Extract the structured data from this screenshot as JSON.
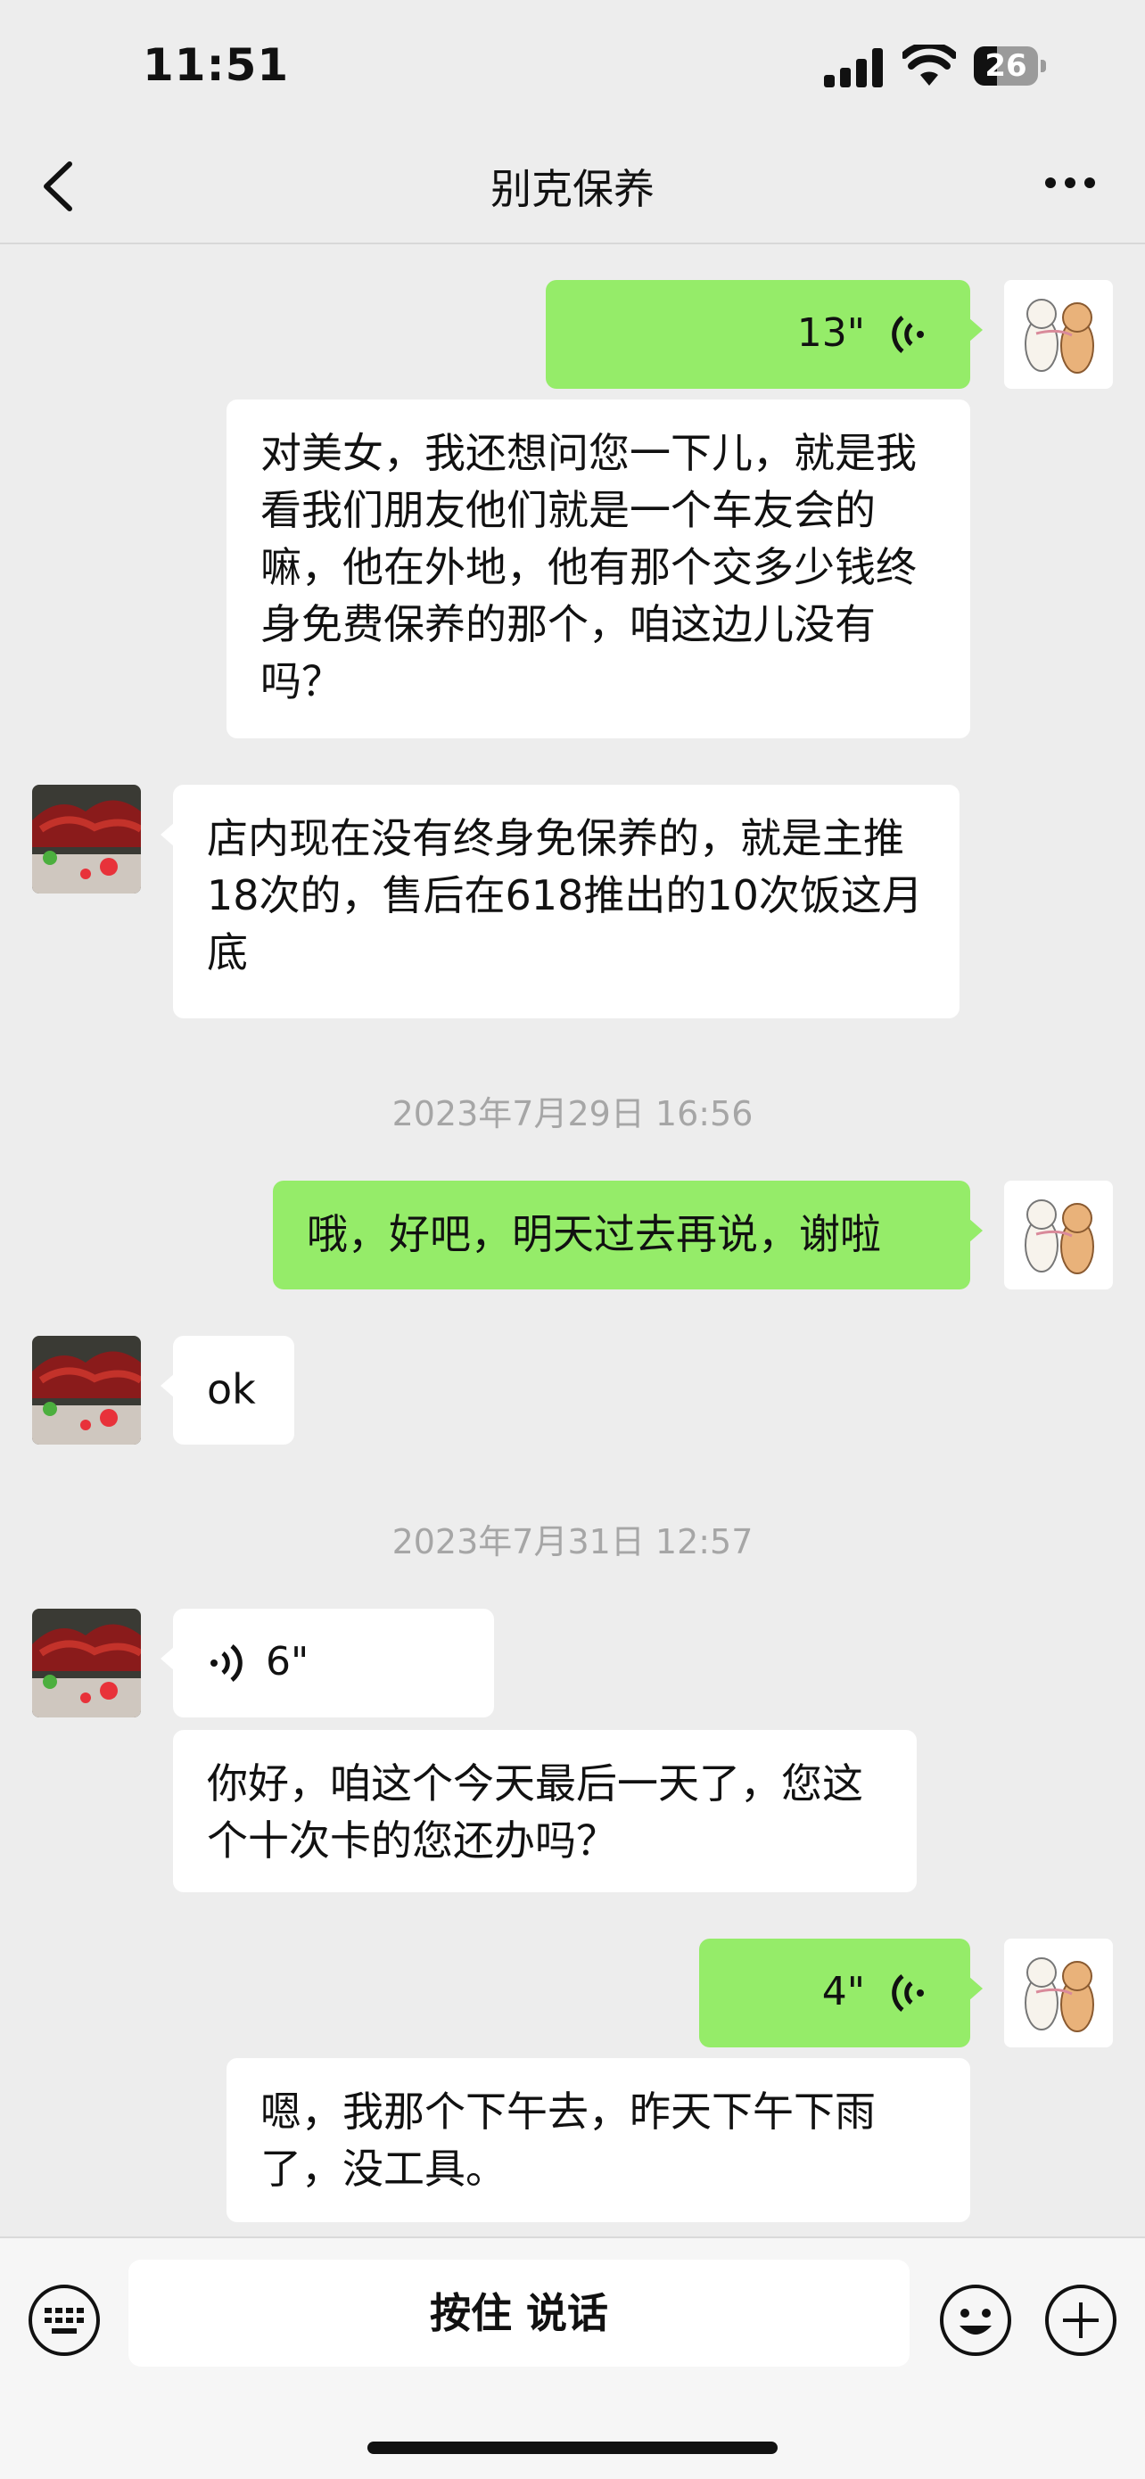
{
  "status": {
    "time": "11:51",
    "battery": "26"
  },
  "nav": {
    "title": "别克保养"
  },
  "messages": [
    {
      "side": "right",
      "kind": "voice",
      "duration": "13\""
    },
    {
      "side": "right",
      "kind": "text",
      "text": "对美女，我还想问您一下儿，就是我看我们朋友他们就是一个车友会的嘛，他在外地，他有那个交多少钱终身免费保养的那个，咱这边儿没有吗？"
    },
    {
      "side": "left",
      "kind": "text",
      "text": "店内现在没有终身免保养的，就是主推18次的，售后在618推出的10次饭这月底"
    },
    {
      "side": "right",
      "kind": "text",
      "text": "哦，好吧，明天过去再说，谢啦"
    },
    {
      "side": "left",
      "kind": "text",
      "text": "ok"
    },
    {
      "side": "left",
      "kind": "voice",
      "duration": "6\""
    },
    {
      "side": "left",
      "kind": "text",
      "text": "你好，咱这个今天最后一天了，您这个十次卡的您还办吗？"
    },
    {
      "side": "right",
      "kind": "voice",
      "duration": "4\""
    },
    {
      "side": "right",
      "kind": "text",
      "text": "嗯，我那个下午去，昨天下午下雨了，没工具。"
    }
  ],
  "timestamps": [
    "2023年7月29日 16:56",
    "2023年7月31日 12:57"
  ],
  "input": {
    "hold_to_talk": "按住 说话"
  },
  "colors": {
    "green_bubble": "#95ec69",
    "background": "#ededed"
  },
  "icons": [
    "back-icon",
    "more-icon",
    "keyboard-icon",
    "emoji-icon",
    "plus-icon",
    "voice-wave-icon"
  ]
}
